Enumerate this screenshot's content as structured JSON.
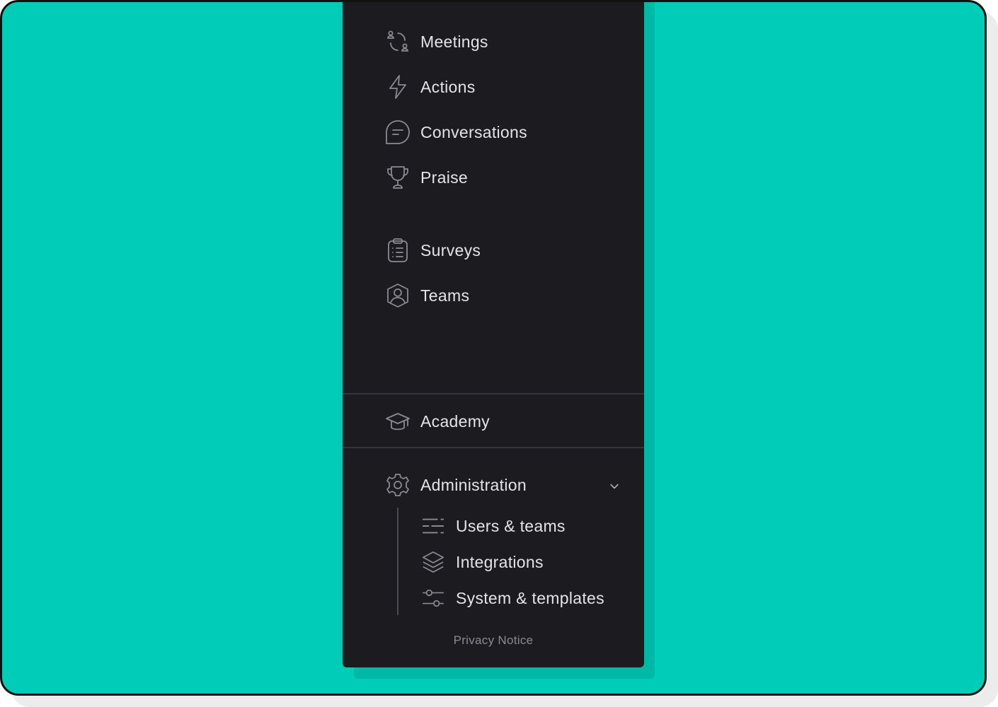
{
  "nav": {
    "primary": [
      {
        "label": "Meetings",
        "icon": "meetings-icon"
      },
      {
        "label": "Actions",
        "icon": "lightning-icon"
      },
      {
        "label": "Conversations",
        "icon": "chat-bubble-icon"
      },
      {
        "label": "Praise",
        "icon": "trophy-icon"
      }
    ],
    "secondary": [
      {
        "label": "Surveys",
        "icon": "clipboard-list-icon"
      },
      {
        "label": "Teams",
        "icon": "user-circle-icon"
      }
    ],
    "academy": {
      "label": "Academy",
      "icon": "graduation-cap-icon"
    },
    "administration": {
      "label": "Administration",
      "icon": "gear-icon",
      "expanded": true,
      "children": [
        {
          "label": "Users & teams",
          "icon": "lines-icon"
        },
        {
          "label": "Integrations",
          "icon": "layers-icon"
        },
        {
          "label": "System & templates",
          "icon": "sliders-icon"
        }
      ]
    }
  },
  "footer": {
    "privacy_label": "Privacy Notice"
  },
  "colors": {
    "background": "#00ccb8",
    "panel": "#1c1c20",
    "text": "#e4e4e6",
    "icon": "#8a8a90",
    "muted": "#8a8a90"
  }
}
